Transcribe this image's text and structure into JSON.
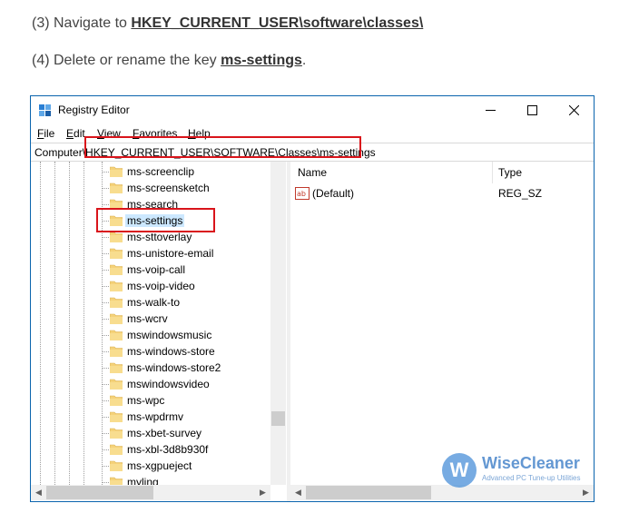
{
  "instructions": {
    "step1_prefix": "(3) Navigate to ",
    "step1_key": "HKEY_CURRENT_USER\\software\\classes\\",
    "step2_prefix": "(4) Delete or rename the key ",
    "step2_key": "ms-settings",
    "step2_suffix": "."
  },
  "window": {
    "title": "Registry Editor",
    "menu": [
      "File",
      "Edit",
      "View",
      "Favorites",
      "Help"
    ],
    "address": "Computer\\HKEY_CURRENT_USER\\SOFTWARE\\Classes\\ms-settings"
  },
  "tree": {
    "items": [
      "ms-screenclip",
      "ms-screensketch",
      "ms-search",
      "ms-settings",
      "ms-sttoverlay",
      "ms-unistore-email",
      "ms-voip-call",
      "ms-voip-video",
      "ms-walk-to",
      "ms-wcrv",
      "mswindowsmusic",
      "ms-windows-store",
      "ms-windows-store2",
      "mswindowsvideo",
      "ms-wpc",
      "ms-wpdrmv",
      "ms-xbet-survey",
      "ms-xbl-3d8b930f",
      "ms-xgpueject",
      "myling"
    ],
    "selected": "ms-settings"
  },
  "values": {
    "columns": {
      "name": "Name",
      "type": "Type"
    },
    "rows": [
      {
        "name": "(Default)",
        "type": "REG_SZ"
      }
    ]
  },
  "watermark": {
    "letter": "W",
    "brand": "WiseCleaner",
    "tagline": "Advanced PC Tune-up Utilities"
  },
  "colors": {
    "highlight_red": "#d9141b",
    "folder_yellow": "#f5d27a",
    "selection_blue": "#cce8ff",
    "window_border": "#0a64ad"
  }
}
